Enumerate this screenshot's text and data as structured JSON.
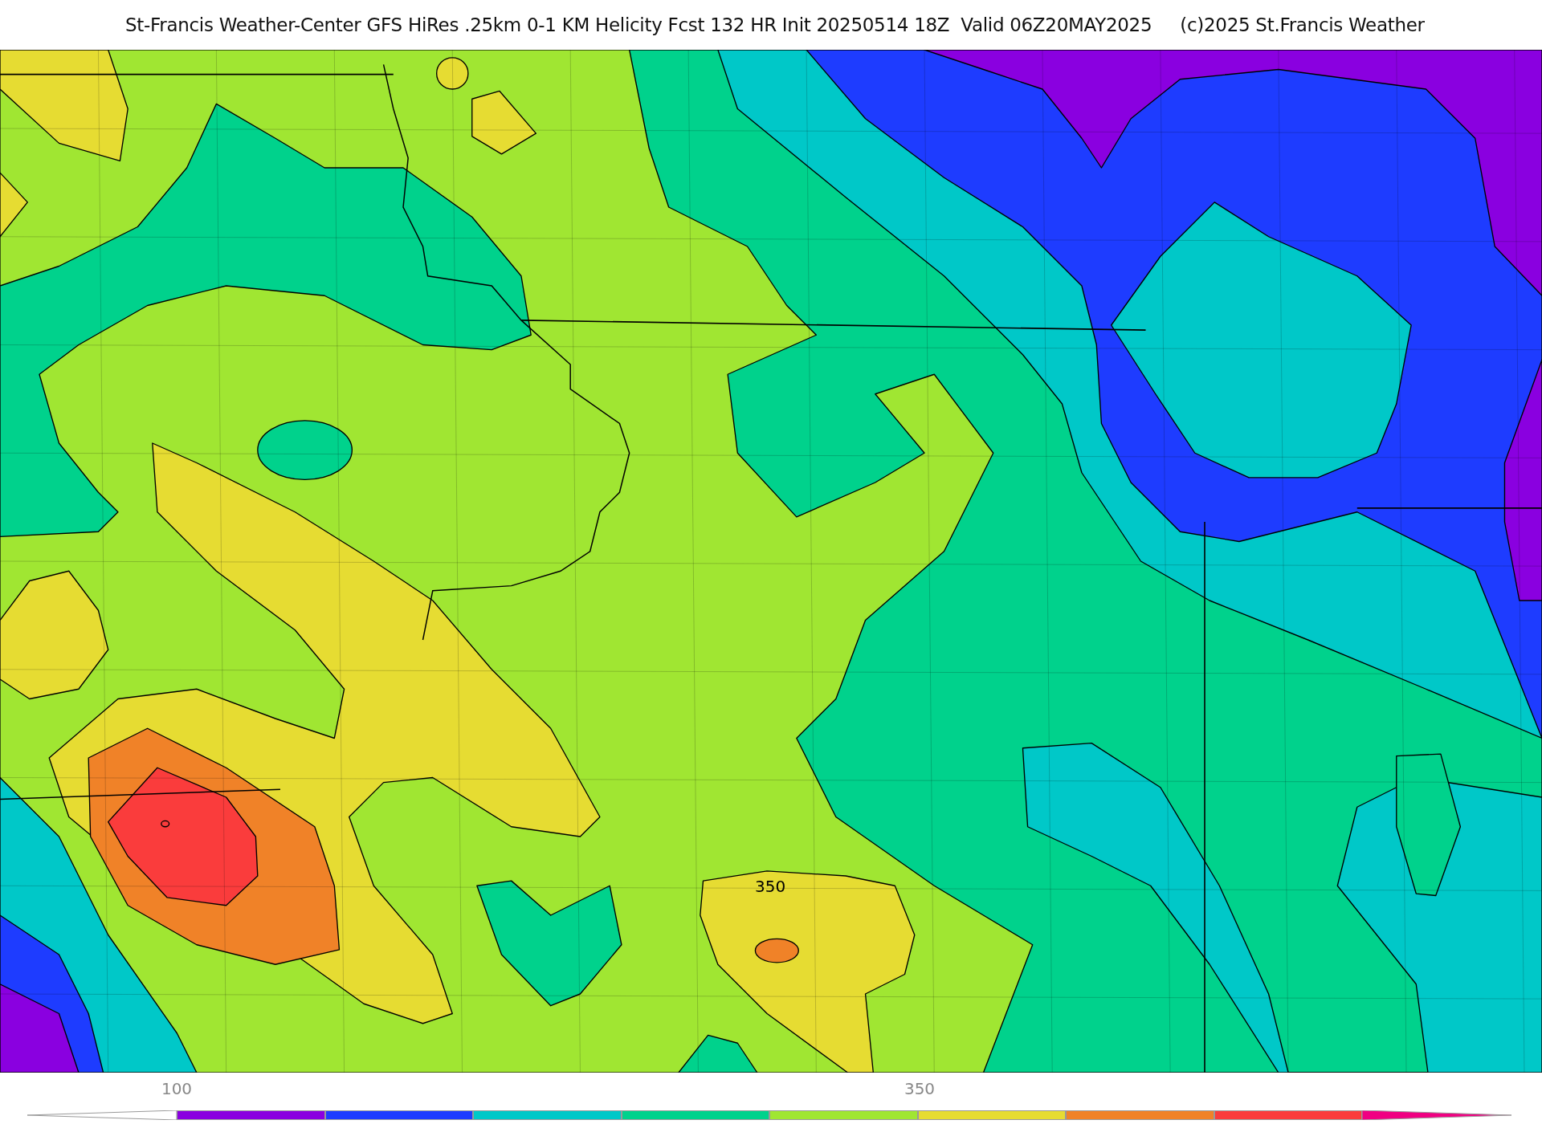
{
  "title": "St-Francis Weather-Center GFS HiRes .25km 0-1 KM Helicity Fcst 132 HR Init 20250514 18Z  Valid 06Z20MAY2025     (c)2025 St.Francis Weather",
  "map": {
    "contour_label": "350"
  },
  "colorbar": {
    "ticks": [
      "100",
      "350"
    ],
    "bins": [
      {
        "kind": "under-arrow",
        "color": "#ffffff"
      },
      {
        "color": "#8a00e0"
      },
      {
        "color": "#1e3cff"
      },
      {
        "color": "#00c8c8"
      },
      {
        "color": "#00d28c"
      },
      {
        "color": "#a0e632"
      },
      {
        "color": "#e6dc32"
      },
      {
        "color": "#f08228"
      },
      {
        "color": "#fa3c3c"
      },
      {
        "kind": "over-arrow",
        "color": "#f00082"
      }
    ]
  }
}
